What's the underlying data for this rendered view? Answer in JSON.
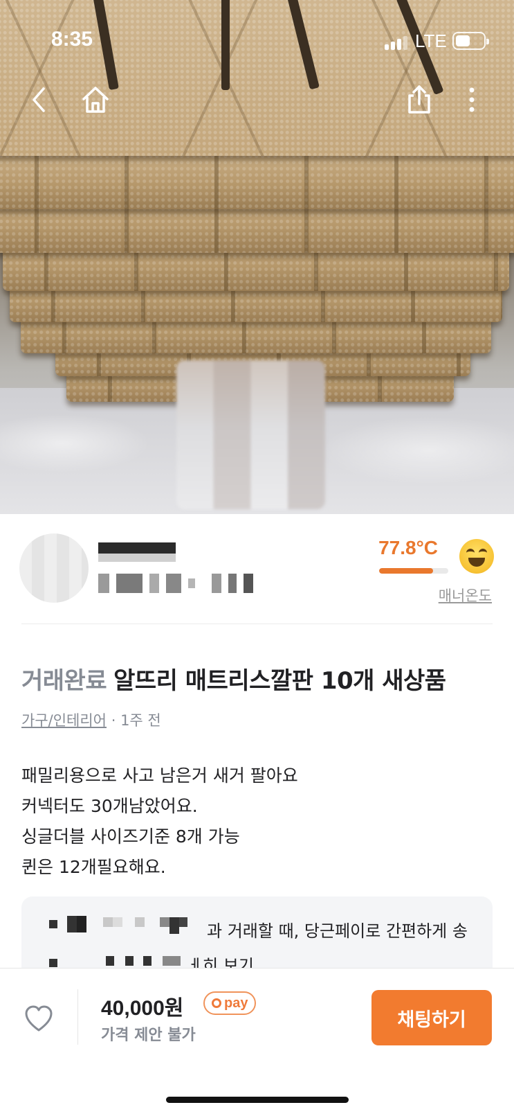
{
  "status_bar": {
    "time": "8:35",
    "network": "LTE"
  },
  "nav": {
    "back_icon": "chevron-left-icon",
    "home_icon": "home-icon",
    "share_icon": "share-icon",
    "more_icon": "more-vertical-icon"
  },
  "seller": {
    "manner_temp": "77.8°C",
    "manner_temp_level": 0.78,
    "manner_label": "매너온도",
    "emoji_icon": "laughing-face-icon"
  },
  "post": {
    "status_label": "거래완료",
    "title": "알뜨리 매트리스깔판 10개 새상품",
    "category": "가구/인테리어",
    "separator": "·",
    "time_ago": "1주 전",
    "body_lines": [
      "패밀리용으로 사고 남은거 새거 팔아요",
      "커넥터도 30개남았어요.",
      "싱글더블 사이즈기준 8개 가능",
      "퀸은 12개필요해요."
    ]
  },
  "pay_banner": {
    "line1_visible": "과 거래할 때, 당근페이로 간편하게 송",
    "line2_visible": "ㅔ히 보기"
  },
  "bottom_bar": {
    "price": "40,000원",
    "pay_badge": "pay",
    "negotiation": "가격 제안 불가",
    "chat_button": "채팅하기"
  },
  "colors": {
    "accent": "#f27b2f",
    "temp": "#e9782d",
    "muted": "#868b94"
  }
}
